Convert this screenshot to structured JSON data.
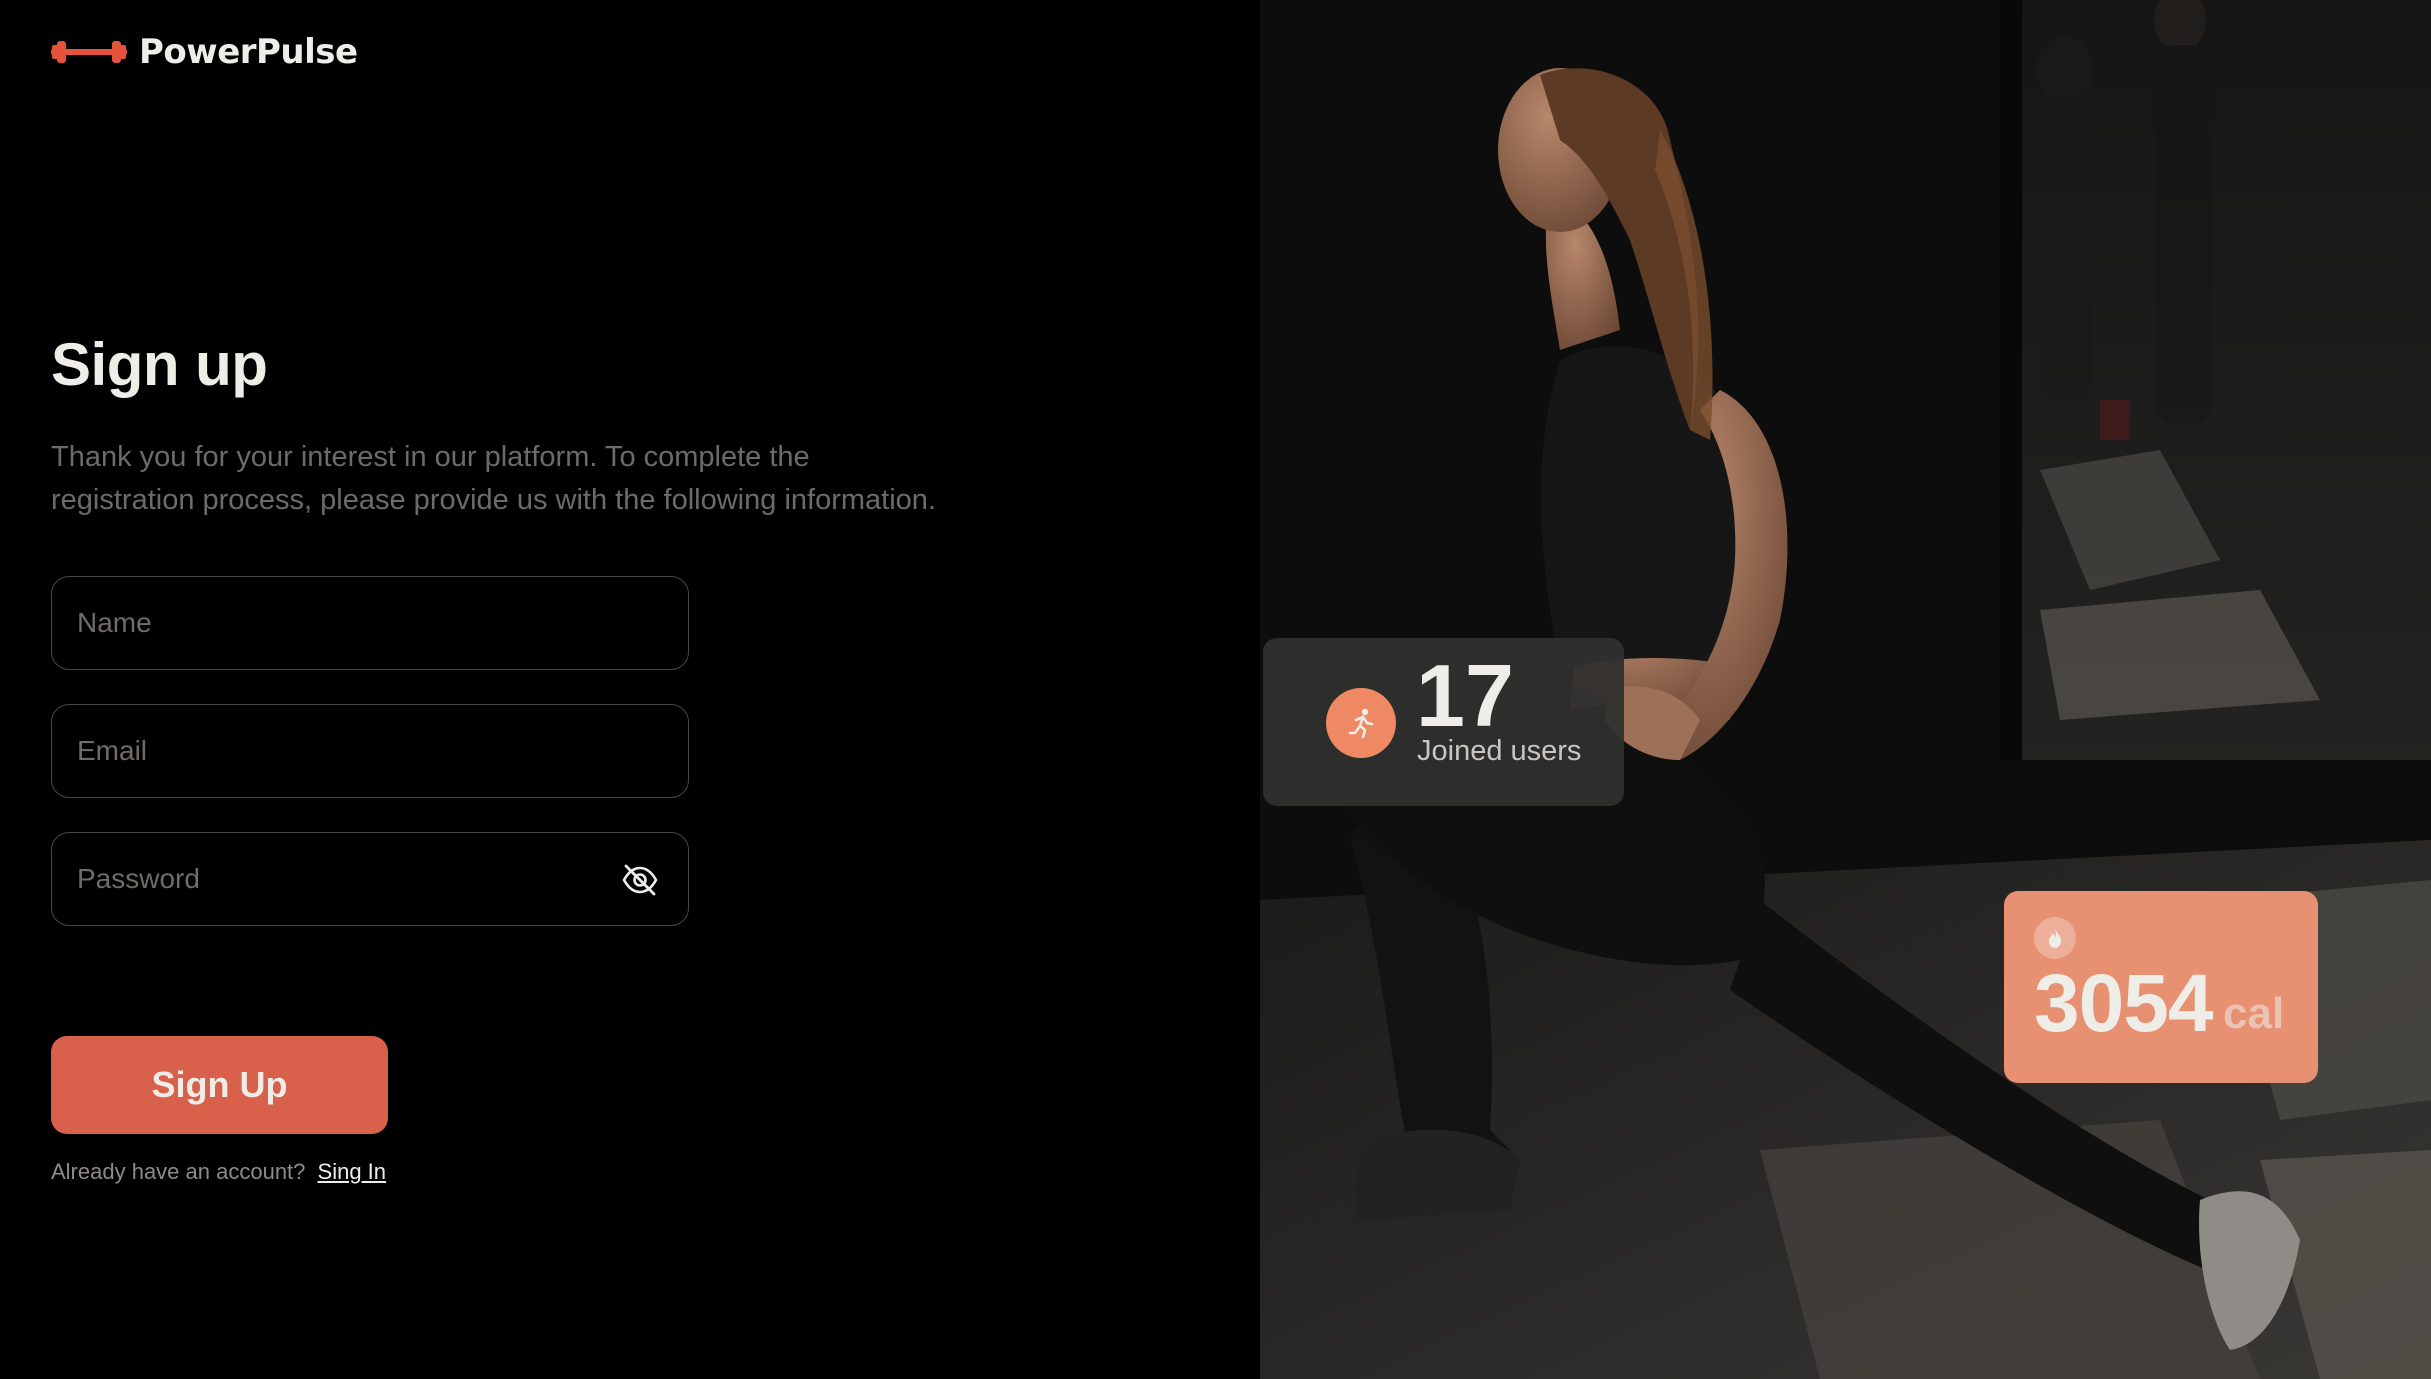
{
  "brand": {
    "name": "PowerPulse",
    "accent_color": "#E6533C",
    "logo_icon": "dumbbell-icon"
  },
  "signup": {
    "title": "Sign up",
    "subtitle_line1": "Thank you for your interest in our platform. To complete the",
    "subtitle_line2": "registration process, please provide us with the following information.",
    "name_placeholder": "Name",
    "email_placeholder": "Email",
    "password_placeholder": "Password",
    "password_toggle_icon": "eye-off-icon",
    "submit_label": "Sign Up",
    "signin_prompt": "Already have an account?",
    "signin_link": "Sing In"
  },
  "stats": {
    "users": {
      "value": "17",
      "label": "Joined users",
      "icon": "running-man-icon"
    },
    "calories": {
      "value": "3054",
      "unit": "cal",
      "icon": "flame-icon"
    }
  },
  "colors": {
    "background": "#000000",
    "primary_button": "#D9604A",
    "users_icon_bg": "#EF8964",
    "calories_card_bg": "#E79072"
  }
}
